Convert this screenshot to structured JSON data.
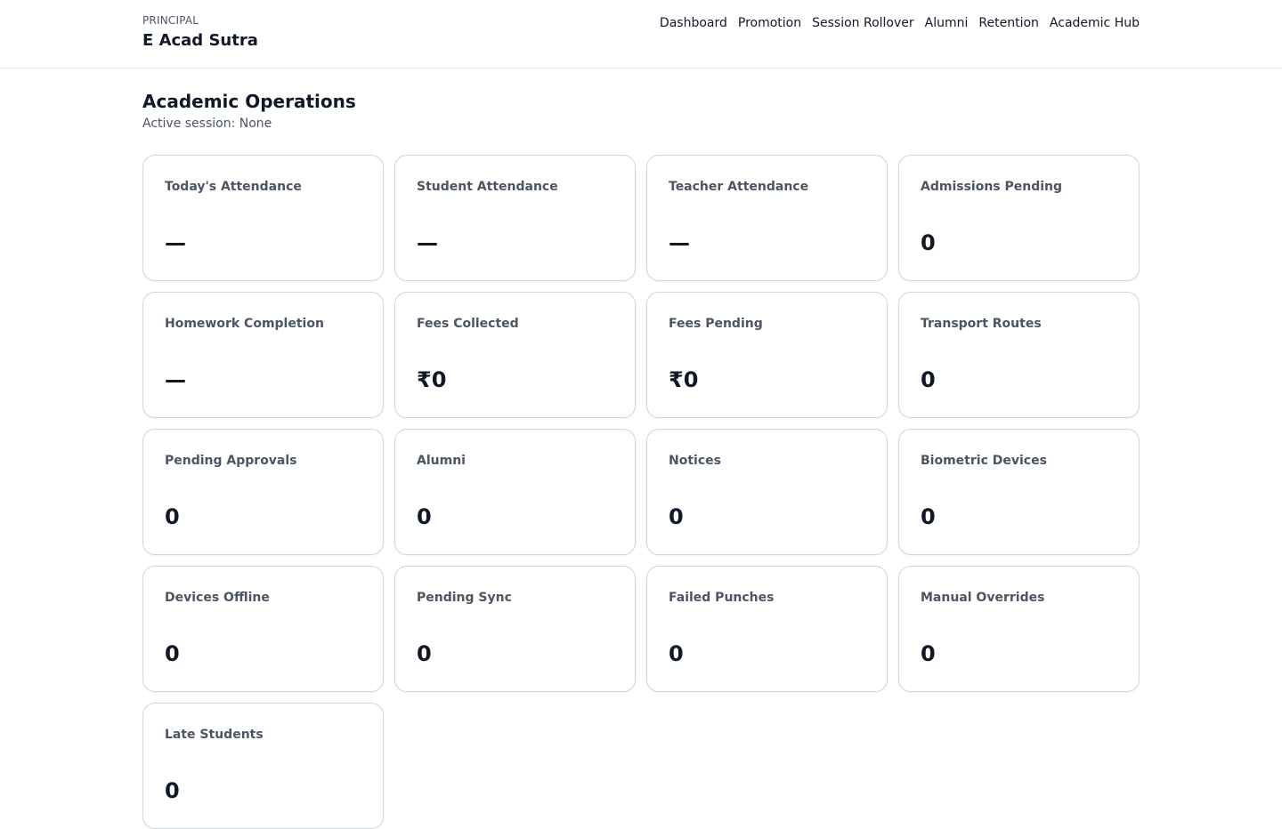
{
  "header": {
    "role": "PRINCIPAL",
    "app_name": "E Acad Sutra",
    "nav": [
      "Dashboard",
      "Promotion",
      "Session Rollover",
      "Alumni",
      "Retention",
      "Academic Hub"
    ]
  },
  "page": {
    "title": "Academic Operations",
    "session": "Active session: None"
  },
  "cards": [
    {
      "label": "Today's Attendance",
      "value": "—"
    },
    {
      "label": "Student Attendance",
      "value": "—"
    },
    {
      "label": "Teacher Attendance",
      "value": "—"
    },
    {
      "label": "Admissions Pending",
      "value": "0"
    },
    {
      "label": "Homework Completion",
      "value": "—"
    },
    {
      "label": "Fees Collected",
      "value": "₹0"
    },
    {
      "label": "Fees Pending",
      "value": "₹0"
    },
    {
      "label": "Transport Routes",
      "value": "0"
    },
    {
      "label": "Pending Approvals",
      "value": "0"
    },
    {
      "label": "Alumni",
      "value": "0"
    },
    {
      "label": "Notices",
      "value": "0"
    },
    {
      "label": "Biometric Devices",
      "value": "0"
    },
    {
      "label": "Devices Offline",
      "value": "0"
    },
    {
      "label": "Pending Sync",
      "value": "0"
    },
    {
      "label": "Failed Punches",
      "value": "0"
    },
    {
      "label": "Manual Overrides",
      "value": "0"
    },
    {
      "label": "Late Students",
      "value": "0"
    }
  ]
}
